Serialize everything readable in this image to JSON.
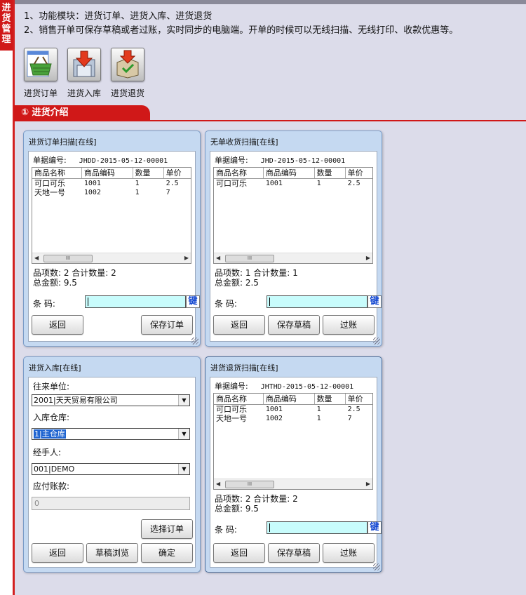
{
  "sidebar": {
    "label": "进货管理"
  },
  "intro": {
    "line1": "1、功能模块：进货订单、进货入库、进货退货",
    "line2": "2、销售开单可保存草稿或者过账，实时同步的电脑端。开单的时候可以无线扫描、无线打印、收款优惠等。"
  },
  "modules": [
    {
      "label": "进货订单",
      "icon": "shopping-basket-icon"
    },
    {
      "label": "进货入库",
      "icon": "warehouse-in-icon"
    },
    {
      "label": "进货退货",
      "icon": "return-box-icon"
    }
  ],
  "section": {
    "title": "① 进货介绍"
  },
  "colors": {
    "accent": "#d01818",
    "window_bg": "#c5d9f1",
    "barcode_bg": "#c8fcfc",
    "key_text": "#1045d0"
  },
  "common": {
    "doc_no_label": "单据编号:",
    "col_name": "商品名称",
    "col_code": "商品编码",
    "col_qty": "数量",
    "col_price": "单价",
    "scroll_thumb": "III",
    "barcode_label": "条  码:",
    "key_label": "键",
    "back": "返回",
    "save_draft": "保存草稿",
    "post": "过账"
  },
  "windows": {
    "order": {
      "title": "进货订单扫描[在线]",
      "doc_no": "JHDD-2015-05-12-00001",
      "rows": [
        {
          "name": "可口可乐",
          "code": "1001",
          "qty": "1",
          "price": "2.5"
        },
        {
          "name": "天地一号",
          "code": "1002",
          "qty": "1",
          "price": "7"
        }
      ],
      "stat1": "品项数: 2 合计数量: 2",
      "stat2": "总金额: 9.5",
      "save_order": "保存订单"
    },
    "nobill": {
      "title": "无单收货扫描[在线]",
      "doc_no": "JHD-2015-05-12-00001",
      "rows": [
        {
          "name": "可口可乐",
          "code": "1001",
          "qty": "1",
          "price": "2.5"
        }
      ],
      "stat1": "品项数: 1 合计数量: 1",
      "stat2": "总金额: 2.5"
    },
    "stockin": {
      "title": "进货入库[在线]",
      "partner_label": "往来单位:",
      "partner_value": "2001|天天贸易有限公司",
      "warehouse_label": "入库仓库:",
      "warehouse_value": "1|主仓库",
      "handler_label": "经手人:",
      "handler_value": "001|DEMO",
      "payable_label": "应付账款:",
      "payable_value": "0",
      "select_order": "选择订单",
      "draft_browse": "草稿浏览",
      "confirm": "确定"
    },
    "returns": {
      "title": "进货退货扫描[在线]",
      "doc_no": "JHTHD-2015-05-12-00001",
      "rows": [
        {
          "name": "可口可乐",
          "code": "1001",
          "qty": "1",
          "price": "2.5"
        },
        {
          "name": "天地一号",
          "code": "1002",
          "qty": "1",
          "price": "7"
        }
      ],
      "stat1": "品项数: 2 合计数量: 2",
      "stat2": "总金额: 9.5"
    }
  }
}
